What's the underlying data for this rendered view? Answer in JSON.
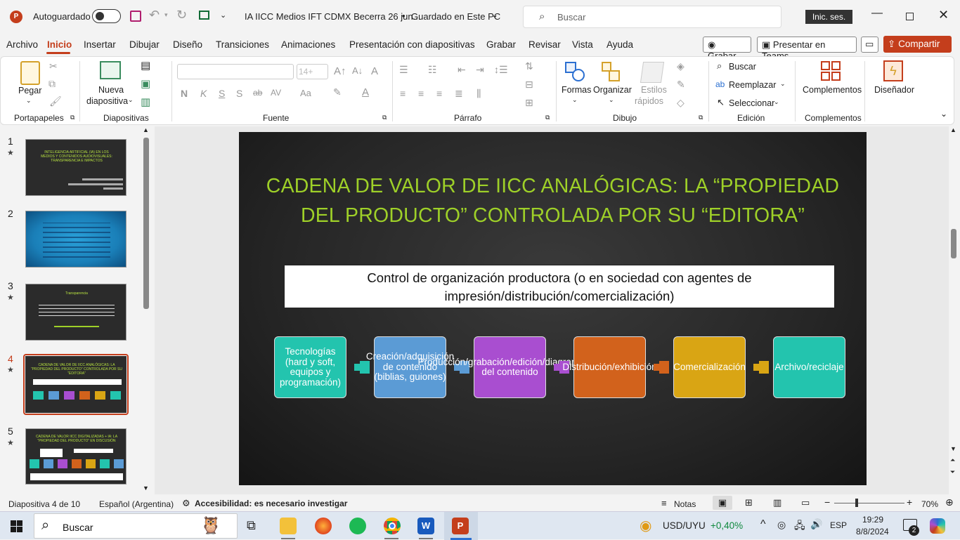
{
  "titlebar": {
    "autosave_label": "Autoguardado",
    "doc_title": "IA IICC Medios IFT CDMX Becerra 26 jun...",
    "save_status": "Guardado en Este PC",
    "search_placeholder": "Buscar",
    "signin_label": "Inic. ses."
  },
  "menu": {
    "items": [
      "Archivo",
      "Inicio",
      "Insertar",
      "Dibujar",
      "Diseño",
      "Transiciones",
      "Animaciones",
      "Presentación con diapositivas",
      "Grabar",
      "Revisar",
      "Vista",
      "Ayuda"
    ],
    "record_label": "Grabar",
    "teams_label": "Presentar en Teams",
    "share_label": "Compartir",
    "share_color": "#c43e1c"
  },
  "ribbon": {
    "paste_label": "Pegar",
    "new_slide_label1": "Nueva",
    "new_slide_label2": "diapositiva",
    "font_size": "14+",
    "shapes_label": "Formas",
    "organize_label": "Organizar",
    "quick_styles_label1": "Estilos",
    "quick_styles_label2": "rápidos",
    "find_label": "Buscar",
    "replace_label": "Reemplazar",
    "select_label": "Seleccionar",
    "addins_label": "Complementos",
    "designer_label": "Diseñador",
    "groups": {
      "clipboard": "Portapapeles",
      "slides": "Diapositivas",
      "font": "Fuente",
      "paragraph": "Párrafo",
      "drawing": "Dibujo",
      "editing": "Edición",
      "addins": "Complementos"
    }
  },
  "thumbnails": [
    {
      "num": "1",
      "text": "INTELIGENCIA ARTIFICIAL (IA) EN LOS MEDIOS Y CONTENIDOS AUDIOVISUALES: TRANSPARENCIA E IMPACTOS"
    },
    {
      "num": "2",
      "text": ""
    },
    {
      "num": "3",
      "text": "Transparencia"
    },
    {
      "num": "4",
      "text": "CADENA DE VALOR DE IICC ANALÓGICAS: LA “PROPIEDAD DEL PRODUCTO” CONTROLADA POR SU “EDITORA”"
    },
    {
      "num": "5",
      "text": "CADENA DE VALOR IICC DIGITALIZADAS + IA: LA “PROPIEDAD DEL PRODUCTO” EN DISCUSIÓN"
    }
  ],
  "slide": {
    "title": "CADENA DE VALOR DE IICC ANALÓGICAS: LA “PROPIEDAD DEL PRODUCTO” CONTROLADA POR SU “EDITORA”",
    "control_text": "Control de organización productora (o en sociedad con agentes de impresión/distribución/comercialización)",
    "chain": [
      {
        "label": "Tecnologías (hard y soft, equipos y programación)",
        "color": "#23c4ae"
      },
      {
        "label": "Creación/adquisición de contenido (biblias, guiones)",
        "color": "#5b9bd5"
      },
      {
        "label": "Producción/grabación/edición/diagramación del contenido",
        "color": "#a94ed0"
      },
      {
        "label": "Distribución/exhibición",
        "color": "#d2621c"
      },
      {
        "label": "Comercialización",
        "color": "#d9a514"
      },
      {
        "label": "Archivo/reciclaje",
        "color": "#23c4ae"
      }
    ]
  },
  "status": {
    "slide_count": "Diapositiva 4 de 10",
    "language": "Español (Argentina)",
    "accessibility": "Accesibilidad: es necesario investigar",
    "notes": "Notas",
    "zoom": "70%"
  },
  "taskbar": {
    "search": "Buscar",
    "currency": "USD/UYU",
    "currency_change": "+0,40%",
    "lang": "ESP",
    "time": "19:29",
    "date": "8/8/2024",
    "notif_count": "2"
  }
}
